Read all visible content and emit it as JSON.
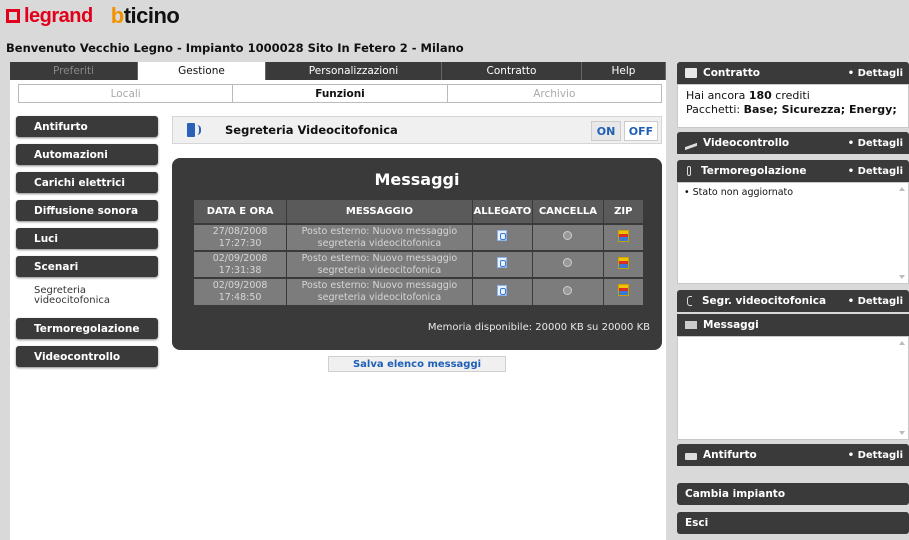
{
  "brand": {
    "legrand": "legrand",
    "bticino_b": "b",
    "bticino_rest": "ticino"
  },
  "welcome": "Benvenuto Vecchio Legno - Impianto 1000028 Sito In Fetero 2 - Milano",
  "main_tabs": [
    {
      "label": "Preferiti",
      "state": "dim"
    },
    {
      "label": "Gestione",
      "state": "active"
    },
    {
      "label": "Personalizzazioni",
      "state": "normal"
    },
    {
      "label": "Contratto",
      "state": "normal"
    },
    {
      "label": "Help",
      "state": "normal"
    }
  ],
  "sub_tabs": [
    {
      "label": "Locali",
      "state": "dim"
    },
    {
      "label": "Funzioni",
      "state": "active"
    },
    {
      "label": "Archivio",
      "state": "dim"
    }
  ],
  "side_menu": [
    {
      "label": "Antifurto"
    },
    {
      "label": "Automazioni"
    },
    {
      "label": "Carichi elettrici"
    },
    {
      "label": "Diffusione sonora"
    },
    {
      "label": "Luci"
    },
    {
      "label": "Scenari"
    },
    {
      "label": "Segreteria videocitofonica",
      "active": true
    },
    {
      "label": "Termoregolazione"
    },
    {
      "label": "Videocontrollo"
    }
  ],
  "function": {
    "title": "Segreteria Videocitofonica",
    "on_label": "ON",
    "off_label": "OFF"
  },
  "messages": {
    "title": "Messaggi",
    "columns": [
      "DATA E ORA",
      "MESSAGGIO",
      "ALLEGATO",
      "CANCELLA",
      "ZIP"
    ],
    "rows": [
      {
        "date": "27/08/2008",
        "time": "17:27:30",
        "msg1": "Posto esterno: Nuovo messaggio",
        "msg2": "segreteria videocitofonica"
      },
      {
        "date": "02/09/2008",
        "time": "17:31:38",
        "msg1": "Posto esterno: Nuovo messaggio",
        "msg2": "segreteria videocitofonica"
      },
      {
        "date": "02/09/2008",
        "time": "17:48:50",
        "msg1": "Posto esterno: Nuovo messaggio",
        "msg2": "segreteria videocitofonica"
      }
    ],
    "memory": "Memoria disponibile: 20000 KB su 20000 KB",
    "save_label": "Salva elenco messaggi"
  },
  "right": {
    "contratto": {
      "title": "Contratto",
      "details": "Dettagli",
      "credits_prefix": "Hai ancora ",
      "credits_value": "180",
      "credits_suffix": " crediti",
      "packages_label": "Pacchetti: ",
      "packages_value": "Base; Sicurezza; Energy;"
    },
    "videocontrollo": {
      "title": "Videocontrollo",
      "details": "Dettagli"
    },
    "termoregolazione": {
      "title": "Termoregolazione",
      "details": "Dettagli",
      "status": "• Stato non aggiornato"
    },
    "segreteria": {
      "title": "Segr. videocitofonica",
      "details": "Dettagli"
    },
    "messaggi": {
      "title": "Messaggi"
    },
    "antifurto": {
      "title": "Antifurto",
      "details": "Dettagli"
    },
    "cambia": "Cambia impianto",
    "esci": "Esci"
  },
  "colors": {
    "dark": "#3a3a3a",
    "accent_blue": "#1f5fb8",
    "legrand_red": "#e2001a",
    "bticino_orange": "#f39200"
  },
  "icons": [
    "phone-icon",
    "attachment-icon",
    "delete-icon",
    "zip-icon",
    "contract-icon",
    "camera-icon",
    "thermometer-icon",
    "intercom-icon",
    "mail-icon",
    "lock-icon"
  ]
}
